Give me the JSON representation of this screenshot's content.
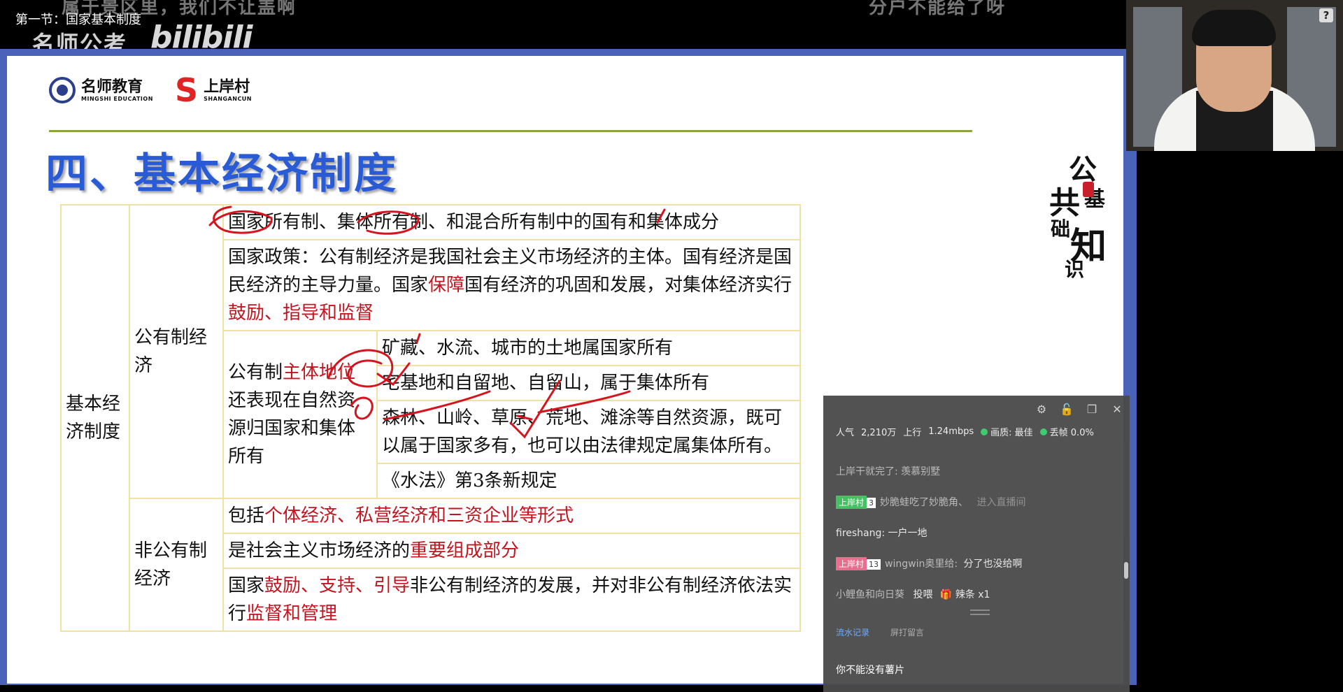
{
  "video": {
    "title": "第一节：国家基本制度",
    "overlay_left": "属于景区里，我们不让盖啊",
    "overlay_right": "分户不能给了呀",
    "watermark": "名师公考",
    "platform": "bilibili"
  },
  "slide": {
    "logo1_cn": "名师教育",
    "logo1_en": "MINGSHI EDUCATION",
    "logo2_cn": "上岸村",
    "logo2_en": "SHANGANCUN",
    "heading": "四、基本经济制度",
    "calligraphy": [
      "公",
      "共",
      "基",
      "础",
      "知",
      "识"
    ],
    "table": {
      "main_category": "基本经济制度",
      "public": {
        "label": "公有制经济",
        "r1": "国家所有制、集体所有制、和混合所有制中的国有和集体成分",
        "r2a": "国家政策：公有制经济是我国社会主义市场经济的主体。国有经济是国民经济的主导力量。国家",
        "r2b": "保障",
        "r2c": "国有经济的巩固和发展，对集体经济实行",
        "r2d": "鼓励、指导和监督",
        "sub_a": "公有制",
        "sub_b": "主体地位",
        "sub_c": "还表现在自然资源归国家和集体所有",
        "s1": "矿藏、水流、城市的土地属国家所有",
        "s2": "宅基地和自留地、自留山，属于集体所有",
        "s3": "森林、山岭、草原、荒地、滩涂等自然资源，既可以属于国家多有，也可以由法律规定属集体所有。",
        "s4": "《水法》第3条新规定"
      },
      "nonpublic": {
        "label": "非公有制经济",
        "n1a": "包括",
        "n1b": "个体经济、私营经济和三资企业等形式",
        "n2a": "是社会主义市场经济的",
        "n2b": "重要组成部分",
        "n3a": "国家",
        "n3b": "鼓励、支持、引导",
        "n3c": "非公有制经济的发展，并对非公有制经济依法实行",
        "n3d": "监督和管理"
      }
    }
  },
  "webcam": {
    "help": "?"
  },
  "chat": {
    "stats": {
      "popularity_label": "人气",
      "popularity": "2,210万",
      "upload_label": "上行",
      "upload": "1.24mbps",
      "quality_label": "画质: 最佳",
      "drop_label": "丢帧 0.0%"
    },
    "messages": [
      {
        "text": "上岸干就完了: 羡慕别墅"
      },
      {
        "badge": "上岸村",
        "level": "3",
        "user": "妙脆蛙吃了妙脆角、",
        "action": "进入直播间"
      },
      {
        "text": "fireshang: 一户一地"
      },
      {
        "badge": "上岸村",
        "level": "13",
        "user": "wingwin奥里给:",
        "content": "分了也没给啊"
      },
      {
        "user": "小鲤鱼和向日葵",
        "action": "投喂",
        "gift": "辣条 x1"
      }
    ],
    "tabs": [
      "流水记录",
      "屏打留言"
    ],
    "warning": "你不能没有薯片"
  }
}
